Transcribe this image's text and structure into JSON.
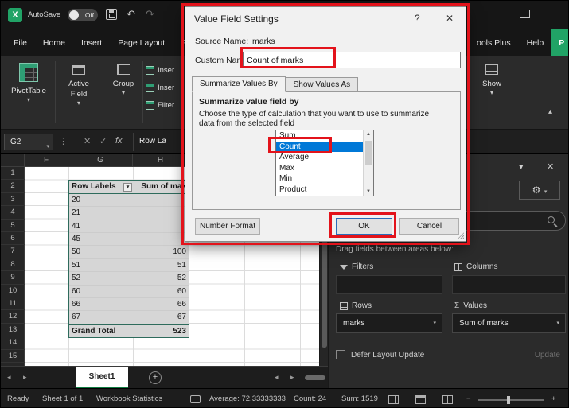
{
  "colors": {
    "excel_green": "#21A366",
    "accent_green": "#107C41",
    "annotation_red": "#E3131B",
    "selection_blue": "#0078D7",
    "pivot_border": "#2E6B5C"
  },
  "titlebar": {
    "autosave_label": "AutoSave",
    "autosave_state": "Off"
  },
  "ribbon": {
    "tabs_left": [
      "File",
      "Home",
      "Insert",
      "Page Layout",
      "For"
    ],
    "tabs_right": [
      "ools Plus",
      "Help"
    ],
    "tab_green": "P",
    "pivottable_label": "PivotTable",
    "active_field_line1": "Active",
    "active_field_line2": "Field",
    "group_label": "Group",
    "insert_buttons": [
      "Inser",
      "Inser",
      "Filter"
    ],
    "show_label": "Show"
  },
  "formula_bar": {
    "name_box": "G2",
    "fx": "fx",
    "content": "Row La"
  },
  "grid": {
    "column_headers": [
      "F",
      "G",
      "H"
    ],
    "row_numbers": [
      "1",
      "2",
      "3",
      "4",
      "5",
      "6",
      "7",
      "8",
      "9",
      "10",
      "11",
      "12",
      "13",
      "14",
      "15"
    ],
    "pivot": {
      "header_label": "Row Labels",
      "header_value": "Sum of mak",
      "rows": [
        {
          "label": "20",
          "value": ""
        },
        {
          "label": "21",
          "value": ""
        },
        {
          "label": "41",
          "value": ""
        },
        {
          "label": "45",
          "value": ""
        },
        {
          "label": "50",
          "value": "100"
        },
        {
          "label": "51",
          "value": "51"
        },
        {
          "label": "52",
          "value": "52"
        },
        {
          "label": "60",
          "value": "60"
        },
        {
          "label": "66",
          "value": "66"
        },
        {
          "label": "67",
          "value": "67"
        }
      ],
      "total_label": "Grand Total",
      "total_value": "523"
    }
  },
  "dialog": {
    "title": "Value Field Settings",
    "help_icon": "?",
    "close_icon": "✕",
    "source_name_label": "Source Name:",
    "source_name_value": "marks",
    "custom_name_label": "Custom Name:",
    "custom_name_value": "Count of marks",
    "tab_active": "Summarize Values By",
    "tab_inactive": "Show Values As",
    "section_title": "Summarize value field by",
    "description_line1": "Choose the type of calculation that you want to use to summarize",
    "description_line2": "data from the selected field",
    "list_items": [
      "Sum",
      "Count",
      "Average",
      "Max",
      "Min",
      "Product"
    ],
    "selected_index": 1,
    "number_format_label": "Number Format",
    "ok_label": "OK",
    "cancel_label": "Cancel"
  },
  "fields_panel": {
    "drag_label": "Drag fields between areas below:",
    "filters_label": "Filters",
    "columns_label": "Columns",
    "rows_label": "Rows",
    "values_label": "Values",
    "rows_value": "marks",
    "values_value": "Sum of marks",
    "defer_label": "Defer Layout Update",
    "update_label": "Update"
  },
  "sheet_bar": {
    "active_tab": "Sheet1"
  },
  "status_bar": {
    "ready": "Ready",
    "sheet_info": "Sheet 1 of 1",
    "workbook_stats": "Workbook Statistics",
    "average": "Average: 72.33333333",
    "count": "Count: 24",
    "sum": "Sum: 1519"
  }
}
